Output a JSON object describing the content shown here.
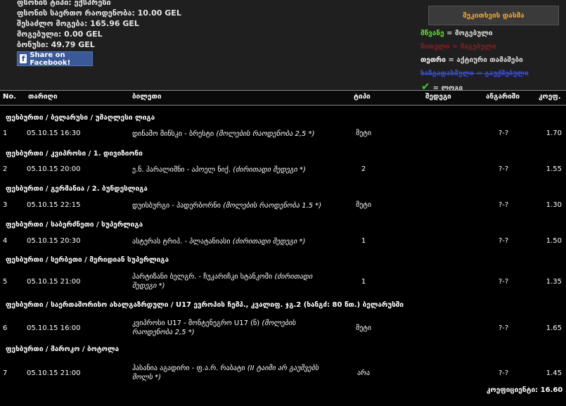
{
  "info": {
    "line1": "ფსონის ტიპი: ექსპრესი",
    "line2_label": "ფსონის საერთო რაოდენობა:",
    "line2_value": "10.00 GEL",
    "line3_label": "შესაძლო მოგება:",
    "line3_value": "165.96 GEL",
    "line4_label": "მოგებული:",
    "line4_value": "0.00 GEL",
    "line5_label": "ბონუსი:",
    "line5_value": "49.79 GEL"
  },
  "facebook_label": "Share on Facebook!",
  "print_label": "შეკითხვის დასმა",
  "legend": {
    "green_word": "მწვანე",
    "green_text": " = მოგებული",
    "red_word": "წითელი",
    "red_text": " = წაგებული",
    "white_word": "თეთრი",
    "white_text": " = აქტიური თამაშები",
    "blue_word": "ხაზგადასმული",
    "blue_text": " = გაუქმებული",
    "check_text": "= ლოგი"
  },
  "columns": {
    "no": "No.",
    "date": "თარიღი",
    "ticket": "ბილეთი",
    "type": "ტიპი",
    "result": "შედეგი",
    "score": "ანგარიში",
    "coef": "კოეფ."
  },
  "rows": [
    {
      "league": "ფეხბურთი / ბელარუსი / უმაღლესი ლიგა",
      "no": "1",
      "date": "05.10.15 16:30",
      "match": "დინამო მინსკი - ბრესტი",
      "note": "(მოლების რაოდენობა 2,5 *)",
      "type": "მეტი",
      "score": "?-?",
      "coef": "1.70"
    },
    {
      "league": "ფეხბურთი / კვიპროსი / 1. დივიზიონი",
      "no": "2",
      "date": "05.10.15 20:00",
      "match": "ე.ნ. პარალიმნი - აპოელ ნიქ.",
      "note": "(ძირითადი შედეგი *)",
      "type": "2",
      "score": "?-?",
      "coef": "1.55"
    },
    {
      "league": "ფეხბურთი / გერმანია / 2. ბუნდესლიგა",
      "no": "3",
      "date": "05.10.15 22:15",
      "match": "დუისბურგი - პადერბორნი",
      "note": "(მოლების რაოდენობა 1.5 *)",
      "type": "მეტი",
      "score": "?-?",
      "coef": "1.30"
    },
    {
      "league": "ფეხბურთი / საბერძნეთი / სუპერლიგა",
      "no": "4",
      "date": "05.10.15 20:30",
      "match": "ასტერას ტრიპ. - პლატანიასი",
      "note": "(ძირითადი შედეგი *)",
      "type": "1",
      "score": "?-?",
      "coef": "1.50"
    },
    {
      "league": "ფეხბურთი / სერბეთი / მერიდიან სუპერლიგა",
      "no": "5",
      "date": "05.10.15 21:00",
      "match": "პარტიზანი ბელგრ. - ჩუკარიჩკი სტანკომი",
      "note": "(ძირითადი შედეგი *)",
      "type": "1",
      "score": "?-?",
      "coef": "1.35"
    },
    {
      "league": "ფეხბურთი / საერთაშორისო ახალგაზრდული / U17 ევროპის ჩემპ., კვალიფ. ჯგ.2 (ხანგძ: 80 წთ.) ბელარუსში",
      "no": "6",
      "date": "05.10.15 16:00",
      "match": "კვიპროსი U17 - მონტენეგრო U17 (ნ)",
      "note": "(მოლების რაოდენობა 2,5 *)",
      "type": "მეტი",
      "score": "?-?",
      "coef": "1.65"
    },
    {
      "league": "ფეხბურთი / მაროკო / ბოტოლა",
      "no": "7",
      "date": "05.10.15 21:00",
      "match": "ჰასანია აგადირი - ფ.ა.რ. რაბატი",
      "note": "(II ტაიმი არ გაუშვებს მოლს *)",
      "type": "არა",
      "score": "?-?",
      "coef": "1.45"
    }
  ],
  "total_label": "კოეფიციენტი:",
  "total_value": "16.60"
}
